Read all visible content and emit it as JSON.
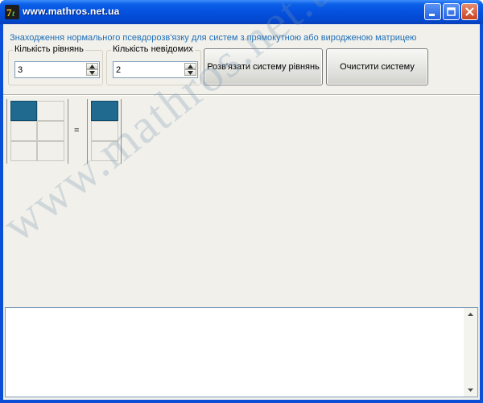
{
  "window": {
    "title": "www.mathros.net.ua",
    "controls": [
      "minimize",
      "maximize",
      "close"
    ]
  },
  "heading": "Знаходження нормального псевдорозв'язку для систем з прямокутною або виродженою матрицею",
  "equations": {
    "label": "Кількість рівнянь",
    "value": "3"
  },
  "unknowns": {
    "label": "Кількість невідомих",
    "value": "2"
  },
  "buttons": {
    "solve": "Розв'язати систему рівнянь",
    "clear": "Очистити систему"
  },
  "matrix": {
    "rows": 3,
    "cols": 2,
    "equals_sign": "="
  },
  "output": {
    "text": ""
  },
  "watermark": "www.mathros.net.ua",
  "colors": {
    "titlebar": "#0551df",
    "heading": "#1f6fb8",
    "selected_cell": "#1f6a8e",
    "client_bg": "#f1f0ea"
  }
}
